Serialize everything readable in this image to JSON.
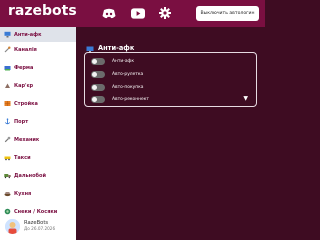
{
  "header": {
    "logo": "razebots",
    "disable_button": "Выключить автологин",
    "icons": [
      "discord-icon",
      "youtube-icon",
      "gear-icon"
    ]
  },
  "sidebar": {
    "items": [
      {
        "label": "Анти-афк",
        "icon": "monitor-icon",
        "active": true
      },
      {
        "label": "Каналія",
        "icon": "tools-icon"
      },
      {
        "label": "Ферма",
        "icon": "farm-icon"
      },
      {
        "label": "Кар'єр",
        "icon": "quarry-icon"
      },
      {
        "label": "Стройка",
        "icon": "construction-icon"
      },
      {
        "label": "Порт",
        "icon": "anchor-icon"
      },
      {
        "label": "Механик",
        "icon": "wrench-icon"
      },
      {
        "label": "Такси",
        "icon": "taxi-icon"
      },
      {
        "label": "Дальнобой",
        "icon": "truck-icon"
      },
      {
        "label": "Кухня",
        "icon": "kitchen-icon"
      },
      {
        "label": "Снеки / Косяки",
        "icon": "snack-icon"
      }
    ],
    "user": {
      "name": "RazeBots",
      "date": "До 26.07.2026"
    }
  },
  "main": {
    "title": "Анти-афк",
    "options": [
      {
        "label": "Анти-афк",
        "enabled": false
      },
      {
        "label": "Авто-рулетка",
        "enabled": false
      },
      {
        "label": "Авто-покупка",
        "enabled": false
      },
      {
        "label": "Авто-реконнект",
        "enabled": false
      }
    ]
  },
  "colors": {
    "header": "#7a0f41",
    "background": "#3e0c22",
    "sidebar": "#ffffff",
    "accent_text": "#7a0f41"
  }
}
